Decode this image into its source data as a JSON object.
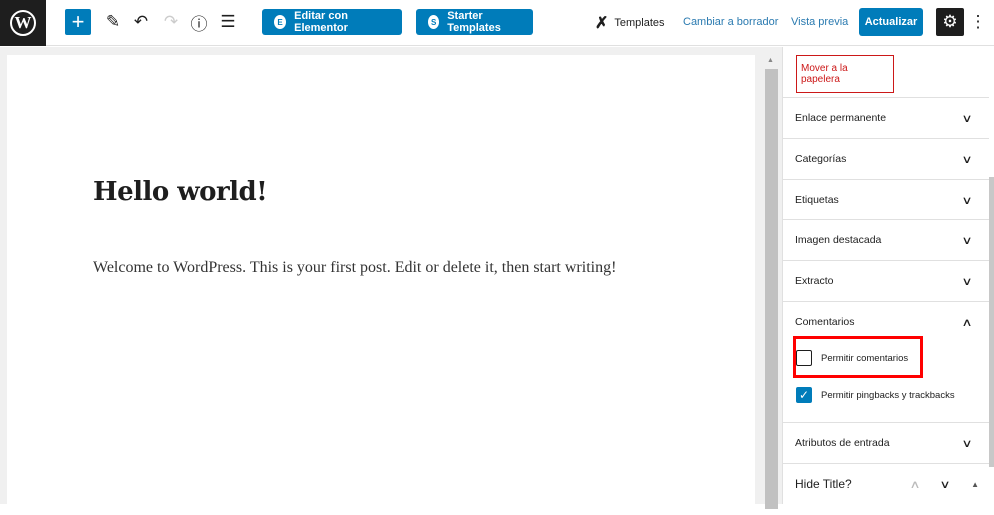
{
  "toolbar": {
    "logo": "W",
    "add": "+",
    "edit_icon": "✎",
    "undo": "↶",
    "redo": "↷",
    "info": "ⓘ",
    "outline": "☰",
    "elementor": "Editar con Elementor",
    "elementor_icon": "E",
    "starter": "Starter Templates",
    "starter_icon": "S",
    "templates": "Templates",
    "templates_icon": "✗",
    "draft": "Cambiar a borrador",
    "preview": "Vista previa",
    "update": "Actualizar",
    "settings": "⚙",
    "more": "⋮"
  },
  "post": {
    "title": "Hello world!",
    "body": "Welcome to WordPress. This is your first post. Edit or delete it, then start writing!"
  },
  "sidebar": {
    "trash": "Mover a la papelera",
    "panels": [
      "Enlace permanente",
      "Categorías",
      "Etiquetas",
      "Imagen destacada",
      "Extracto"
    ],
    "comments": {
      "title": "Comentarios",
      "allow_comments": "Permitir comentarios",
      "allow_comments_checked": false,
      "allow_pingbacks": "Permitir pingbacks y trackbacks",
      "allow_pingbacks_checked": true
    },
    "attributes": "Atributos de entrada",
    "hide_title": "Hide Title?"
  },
  "colors": {
    "accent": "#007cba",
    "danger": "#cc1818",
    "highlight": "#ff0000"
  }
}
